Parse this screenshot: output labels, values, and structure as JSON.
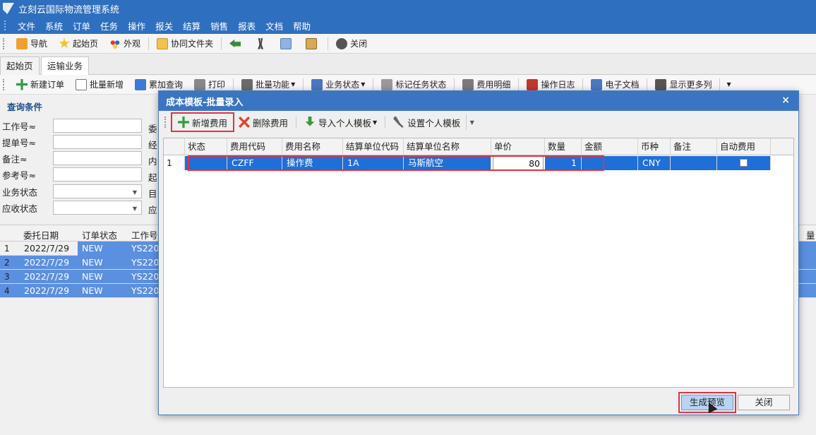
{
  "app": {
    "title": "立刻云国际物流管理系统"
  },
  "menu": [
    "文件",
    "系统",
    "订单",
    "任务",
    "操作",
    "报关",
    "结算",
    "销售",
    "报表",
    "文档",
    "帮助"
  ],
  "toolbar1": {
    "nav": "导航",
    "home": "起始页",
    "appearance": "外观",
    "shared_folder": "协同文件夹",
    "close": "关闭"
  },
  "tabs": [
    "起始页",
    "运输业务"
  ],
  "toolbar2": [
    "新建订单",
    "批量新增",
    "累加查询",
    "打印",
    "批量功能",
    "业务状态",
    "标记任务状态",
    "费用明细",
    "操作日志",
    "电子文档",
    "显示更多列"
  ],
  "query": {
    "title": "查询条件",
    "labels": [
      "工作号≈",
      "提单号≈",
      "备注≈",
      "参考号≈",
      "业务状态",
      "应收状态"
    ],
    "labels_right": [
      "委",
      "经",
      "内",
      "起",
      "目",
      "应"
    ]
  },
  "bg_grid": {
    "headers": [
      "委托日期",
      "订单状态",
      "工作号"
    ],
    "trailing_header": "量",
    "rows": [
      {
        "n": "1",
        "date": "2022/7/29",
        "status": "NEW",
        "job": "YS220"
      },
      {
        "n": "2",
        "date": "2022/7/29",
        "status": "NEW",
        "job": "YS220"
      },
      {
        "n": "3",
        "date": "2022/7/29",
        "status": "NEW",
        "job": "YS220"
      },
      {
        "n": "4",
        "date": "2022/7/29",
        "status": "NEW",
        "job": "YS220"
      }
    ]
  },
  "dialog": {
    "title": "成本模板-批量录入",
    "close_glyph": "×",
    "toolbar": {
      "add": "新增费用",
      "delete": "删除费用",
      "import": "导入个人模板",
      "set_template": "设置个人模板"
    },
    "columns": [
      "状态",
      "费用代码",
      "费用名称",
      "结算单位代码",
      "结算单位名称",
      "单价",
      "数量",
      "金额",
      "币种",
      "备注",
      "自动费用"
    ],
    "rows": [
      {
        "n": "1",
        "status": "",
        "code": "CZFF",
        "name": "操作费",
        "unit_code": "1A",
        "unit_name": "马斯航空",
        "price": "80",
        "qty": "1",
        "amount": "",
        "currency": "CNY",
        "remark": "",
        "auto": false
      }
    ],
    "buttons": {
      "generate": "生成预览",
      "close": "关闭"
    }
  }
}
